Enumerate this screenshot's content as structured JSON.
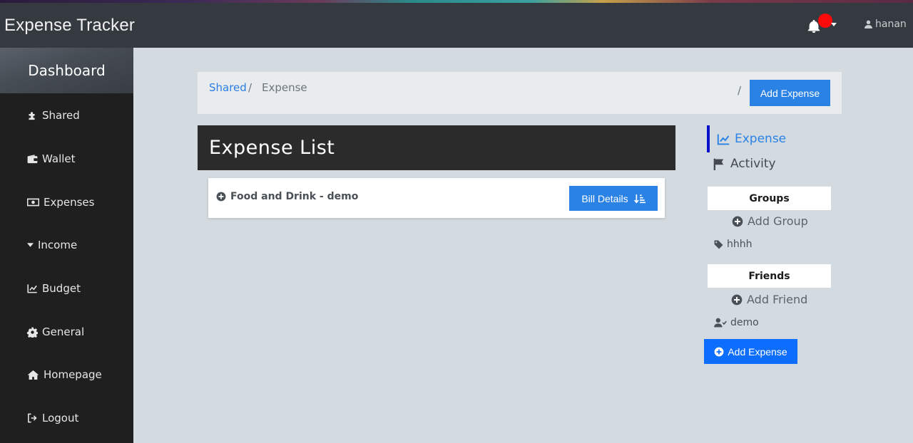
{
  "header": {
    "brand": "Expense Tracker",
    "user_name": "hanan",
    "notification_color": "#ff0a0a"
  },
  "sidebar": {
    "dashboard_label": "Dashboard",
    "items": [
      {
        "label": "Shared",
        "icon": "puzzle-icon"
      },
      {
        "label": "Wallet",
        "icon": "wallet-icon"
      },
      {
        "label": "Expenses",
        "icon": "money-bill-icon"
      },
      {
        "label": "Income",
        "icon": "caret-down-icon"
      },
      {
        "label": "Budget",
        "icon": "chart-line-icon"
      },
      {
        "label": "General",
        "icon": "cog-icon"
      },
      {
        "label": "Homepage",
        "icon": "home-icon"
      },
      {
        "label": "Logout",
        "icon": "sign-out-icon"
      }
    ]
  },
  "breadcrumb": {
    "parent": "Shared",
    "current": "Expense",
    "separator": "/",
    "add_button": "Add Expense"
  },
  "expense_list": {
    "title": "Expense List",
    "items": [
      {
        "label": "Food and Drink - demo",
        "button": "Bill Details"
      }
    ]
  },
  "right_panel": {
    "tabs": {
      "expense": "Expense",
      "activity": "Activity"
    },
    "groups_heading": "Groups",
    "add_group": "Add Group",
    "groups": [
      "hhhh"
    ],
    "friends_heading": "Friends",
    "add_friend": "Add Friend",
    "friends": [
      "demo"
    ],
    "add_expense": "Add Expense"
  },
  "colors": {
    "accent": "#2a82e4",
    "active_tab_border": "#0a11cc",
    "sidebar_bg": "#1f1f1f",
    "header_bg": "#343a40"
  }
}
